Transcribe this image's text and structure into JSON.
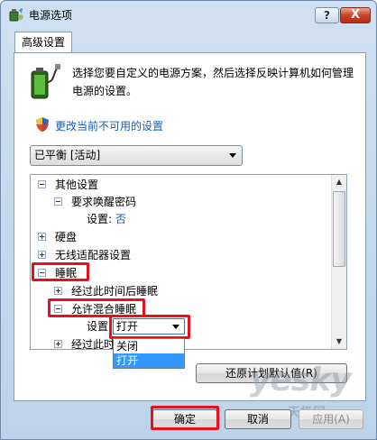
{
  "window": {
    "title": "电源选项",
    "help_label": "?",
    "close_label": "X"
  },
  "tab": {
    "label": "高级设置"
  },
  "intro": {
    "text": "选择您要自定义的电源方案，然后选择反映计算机如何管理电源的设置。",
    "change_link": "更改当前不可用的设置"
  },
  "plan_select": {
    "value": "已平衡 [活动]"
  },
  "tree": {
    "other_settings": "其他设置",
    "require_password": "要求唤醒密码",
    "setting_label": "设置:",
    "setting_value": "否",
    "hard_disk": "硬盘",
    "wireless_adapter": "无线适配器设置",
    "sleep": "睡眠",
    "sleep_after": "经过此时间后睡眠",
    "hybrid_sleep": "允许混合睡眠",
    "hybrid_setting_label": "设置",
    "hybrid_select_value": "打开",
    "hibernate_after": "经过此时"
  },
  "dropdown": {
    "options": [
      "关闭",
      "打开"
    ],
    "selected_index": 1
  },
  "buttons": {
    "restore_defaults": "还原计划默认值(R)",
    "ok": "确定",
    "cancel": "取消",
    "apply": "应用(A)"
  },
  "watermark": {
    "text": "yesky",
    "sub": "天极网"
  },
  "colors": {
    "highlight": "#e8101c",
    "link": "#1a5bb5",
    "selection": "#3399ff"
  }
}
